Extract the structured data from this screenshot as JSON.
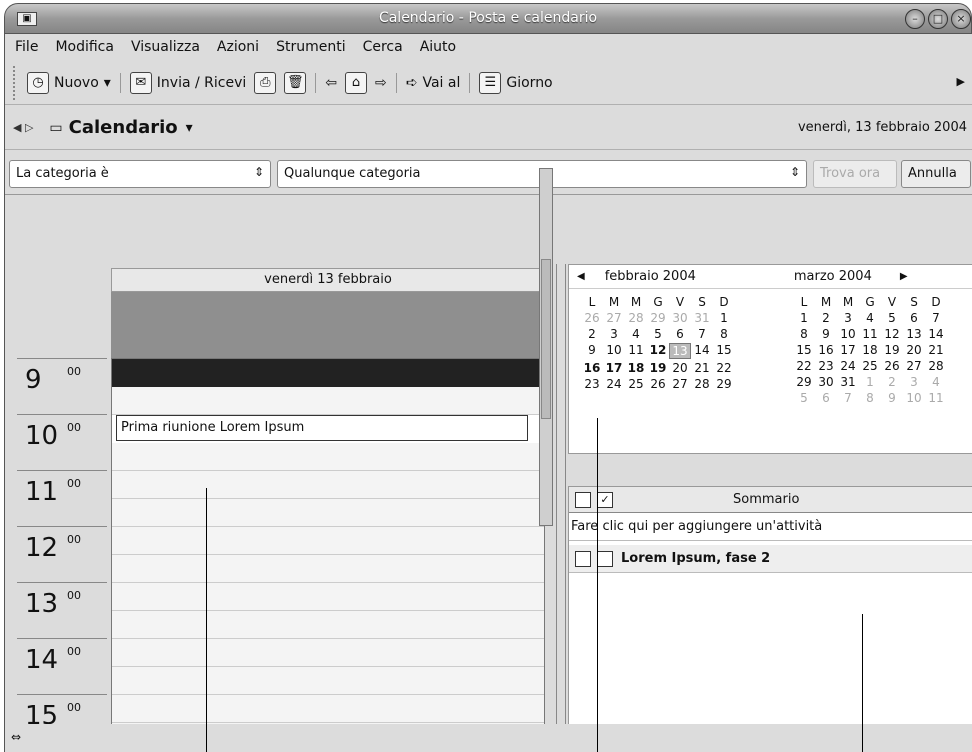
{
  "window": {
    "title": "Calendario - Posta e calendario"
  },
  "menu": [
    "File",
    "Modifica",
    "Visualizza",
    "Azioni",
    "Strumenti",
    "Cerca",
    "Aiuto"
  ],
  "toolbar": {
    "new": "Nuovo",
    "send": "Invia / Ricevi",
    "goto": "Vai al",
    "day": "Giorno"
  },
  "calbar": {
    "title": "Calendario",
    "date": "venerdì, 13 febbraio 2004"
  },
  "filter": {
    "field": "La categoria è",
    "value": "Qualunque categoria",
    "find": "Trova ora",
    "cancel": "Annulla"
  },
  "day": {
    "header": "venerdì 13 febbraio",
    "event": "Prima riunione Lorem Ipsum"
  },
  "hours": [
    {
      "h": "9",
      "m": "00"
    },
    {
      "h": "10",
      "m": "00"
    },
    {
      "h": "11",
      "m": "00"
    },
    {
      "h": "12",
      "m": "00"
    },
    {
      "h": "13",
      "m": "00"
    },
    {
      "h": "14",
      "m": "00"
    },
    {
      "h": "15",
      "m": "00"
    }
  ],
  "minical": {
    "months": [
      "febbraio 2004",
      "marzo 2004"
    ],
    "weekdays": [
      "L",
      "M",
      "M",
      "G",
      "V",
      "S",
      "D"
    ],
    "feb": [
      "26",
      "27",
      "28",
      "29",
      "30",
      "31",
      "1",
      "2",
      "3",
      "4",
      "5",
      "6",
      "7",
      "8",
      "9",
      "10",
      "11",
      "12",
      "13",
      "14",
      "15",
      "16",
      "17",
      "18",
      "19",
      "20",
      "21",
      "22",
      "23",
      "24",
      "25",
      "26",
      "27",
      "28",
      "29"
    ],
    "mar": [
      "1",
      "2",
      "3",
      "4",
      "5",
      "6",
      "7",
      "8",
      "9",
      "10",
      "11",
      "12",
      "13",
      "14",
      "15",
      "16",
      "17",
      "18",
      "19",
      "20",
      "21",
      "22",
      "23",
      "24",
      "25",
      "26",
      "27",
      "28",
      "29",
      "30",
      "31",
      "1",
      "2",
      "3",
      "4",
      "5",
      "6",
      "7",
      "8",
      "9",
      "10",
      "11"
    ]
  },
  "tasks": {
    "header": "Sommario",
    "hint": "Fare clic qui per aggiungere un'attività",
    "item": "Lorem Ipsum, fase 2"
  }
}
